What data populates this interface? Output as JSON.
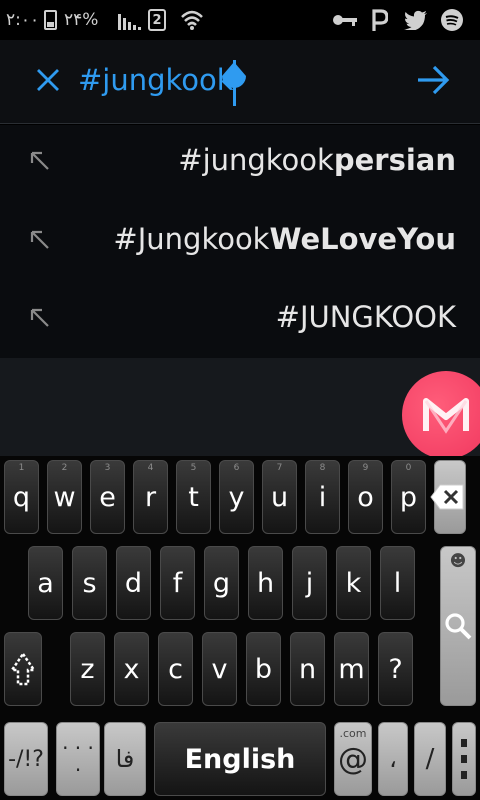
{
  "status_bar": {
    "time": "۲:۰۰",
    "battery_percent": "۲۴%",
    "sim_slot": "2"
  },
  "search": {
    "query": "#jungkook"
  },
  "suggestions": [
    {
      "prefix": "#jungkook",
      "bold": "persian"
    },
    {
      "prefix": "#Jungkook",
      "bold": "WeLoveYou"
    },
    {
      "prefix": "#JUNGKOOK",
      "bold": ""
    }
  ],
  "keyboard": {
    "row1": [
      {
        "label": "q",
        "hint": "1"
      },
      {
        "label": "w",
        "hint": "2"
      },
      {
        "label": "e",
        "hint": "3"
      },
      {
        "label": "r",
        "hint": "4"
      },
      {
        "label": "t",
        "hint": "5"
      },
      {
        "label": "y",
        "hint": "6"
      },
      {
        "label": "u",
        "hint": "7"
      },
      {
        "label": "i",
        "hint": "8"
      },
      {
        "label": "o",
        "hint": "9"
      },
      {
        "label": "p",
        "hint": "0"
      }
    ],
    "row2": [
      "a",
      "s",
      "d",
      "f",
      "g",
      "h",
      "j",
      "k",
      "l"
    ],
    "row3": [
      "z",
      "x",
      "c",
      "v",
      "b",
      "n",
      "m",
      "?"
    ],
    "symbols_label": "-/!?",
    "dots_top": "· · ·",
    "dots_bottom": "·",
    "persian_label": "فا",
    "space_label": "English",
    "at_label": "@",
    "dotcom_label": ".com",
    "comma_label": "،",
    "slash_label": "/",
    "smiley_label": "☻"
  }
}
